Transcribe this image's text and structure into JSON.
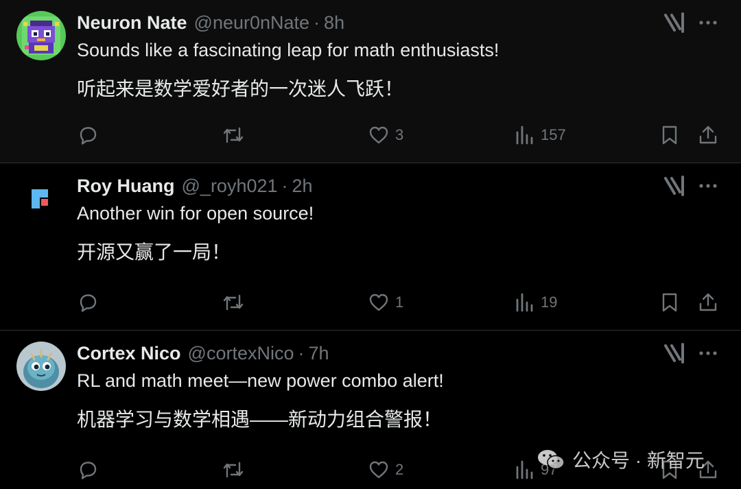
{
  "tweets": [
    {
      "name": "Neuron Nate",
      "handle": "@neur0nNate",
      "sep": "·",
      "time": "8h",
      "text_en": "Sounds like a fascinating leap for math enthusiasts!",
      "text_zh": "听起来是数学爱好者的一次迷人飞跃！",
      "replies": "",
      "reposts": "",
      "likes": "3",
      "views": "157",
      "avatar": "purple-robot-avatar"
    },
    {
      "name": "Roy Huang",
      "handle": "@_royh021",
      "sep": "·",
      "time": "2h",
      "text_en": "Another win for open source!",
      "text_zh": "开源又赢了一局！",
      "replies": "",
      "reposts": "",
      "likes": "1",
      "views": "19",
      "avatar": "blue-square-logo-avatar"
    },
    {
      "name": "Cortex Nico",
      "handle": "@cortexNico",
      "sep": "·",
      "time": "7h",
      "text_en": "RL and math meet—new power combo alert!",
      "text_zh": "机器学习与数学相遇——新动力组合警报！",
      "replies": "",
      "reposts": "",
      "likes": "2",
      "views": "97",
      "avatar": "blue-dragon-avatar"
    }
  ],
  "watermark": {
    "text": "公众号 · 新智元",
    "icon": "wechat-icon"
  },
  "colors": {
    "background": "#000000",
    "text": "#e7e9ea",
    "muted": "#71767b",
    "divider": "#2f3336"
  }
}
